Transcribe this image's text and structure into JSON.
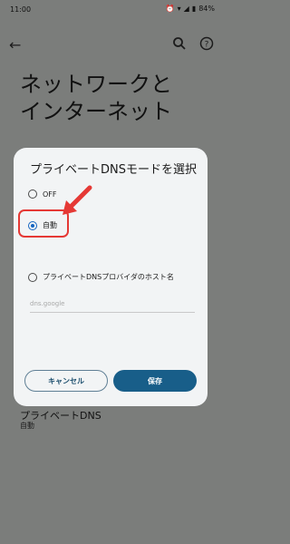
{
  "status_bar": {
    "time": "11:00",
    "battery": "84%"
  },
  "background": {
    "title_line1": "ネットワークと",
    "title_line2": "インターネット",
    "pref_title": "プライベートDNS",
    "pref_subtitle": "自動"
  },
  "dialog": {
    "title": "プライベートDNSモードを選択",
    "options": [
      {
        "label": "OFF",
        "selected": false
      },
      {
        "label": "自動",
        "selected": true
      },
      {
        "label": "プライベートDNSプロバイダのホスト名",
        "selected": false
      }
    ],
    "hostname_placeholder": "dns.google",
    "cancel_label": "キャンセル",
    "save_label": "保存"
  },
  "colors": {
    "accent": "#185e89",
    "highlight": "#e53935"
  }
}
